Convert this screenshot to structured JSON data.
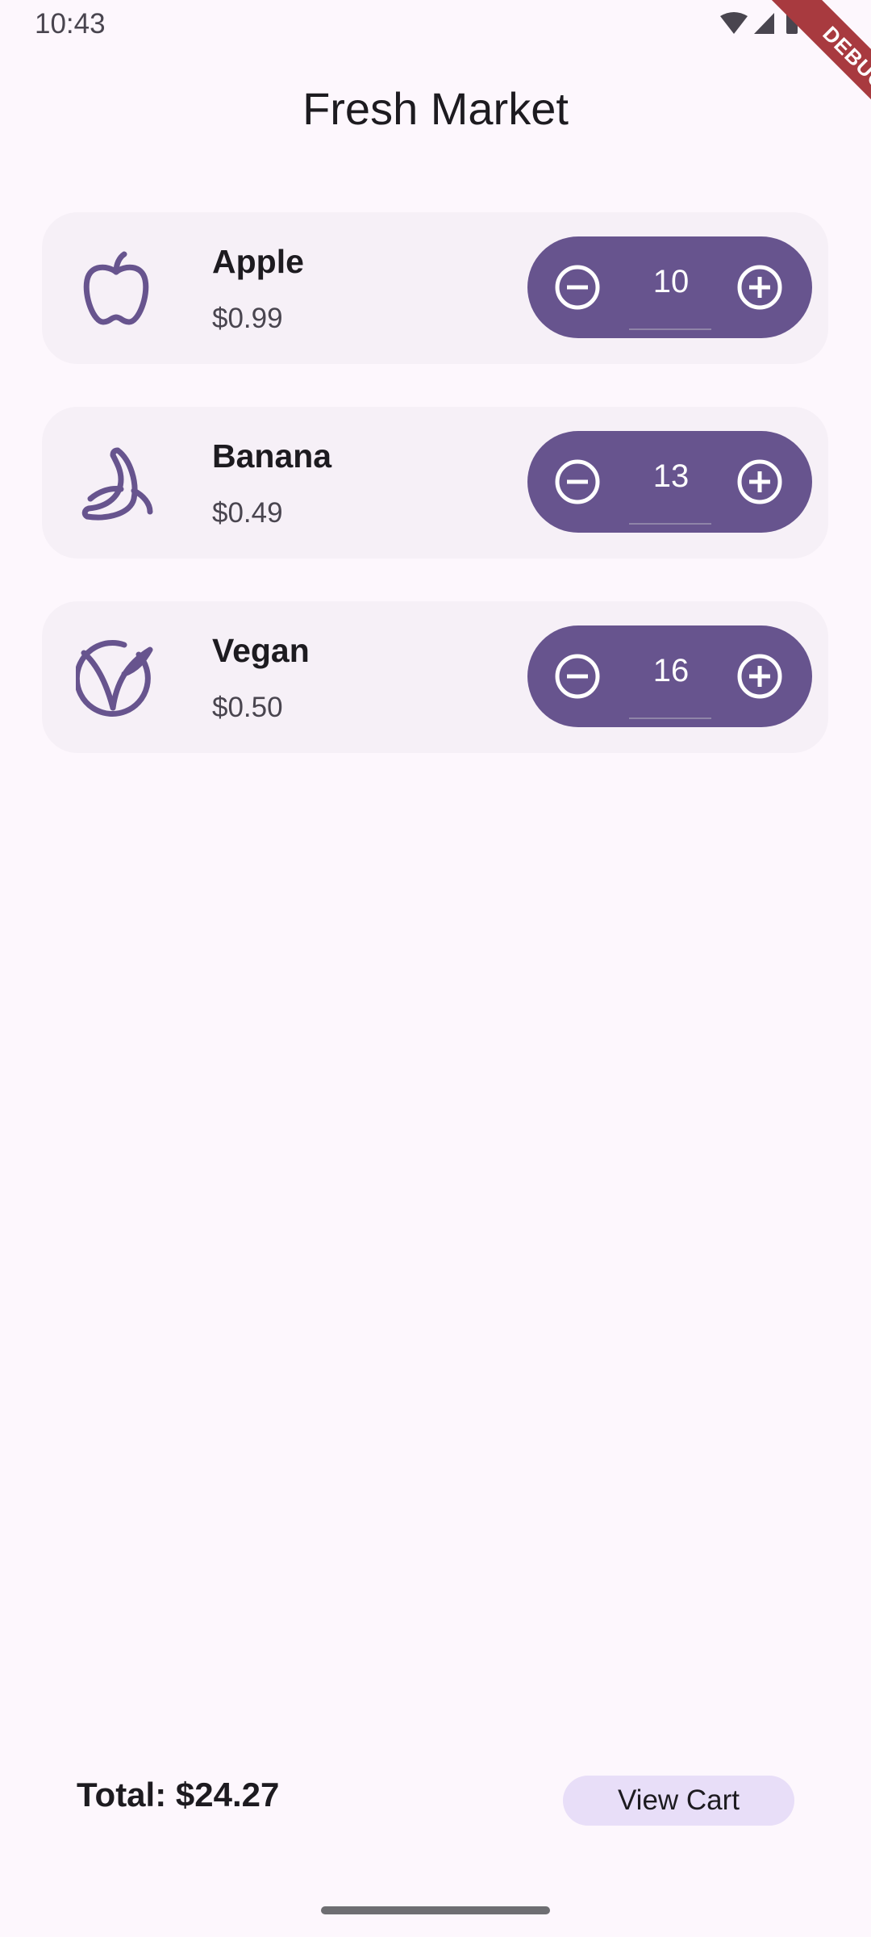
{
  "status_bar": {
    "time": "10:43"
  },
  "debug_banner": "DEBUG",
  "app_bar": {
    "title": "Fresh Market"
  },
  "products": [
    {
      "name": "Apple",
      "price": "$0.99",
      "quantity": "10",
      "icon": "apple-icon"
    },
    {
      "name": "Banana",
      "price": "$0.49",
      "quantity": "13",
      "icon": "banana-icon"
    },
    {
      "name": "Vegan",
      "price": "$0.50",
      "quantity": "16",
      "icon": "vegan-icon"
    }
  ],
  "footer": {
    "total": "Total: $24.27",
    "view_cart_label": "View Cart"
  },
  "colors": {
    "accent": "#67548e",
    "background": "#fdf7fd",
    "card": "#f6f0f7",
    "button_tonal": "#e8def8"
  }
}
